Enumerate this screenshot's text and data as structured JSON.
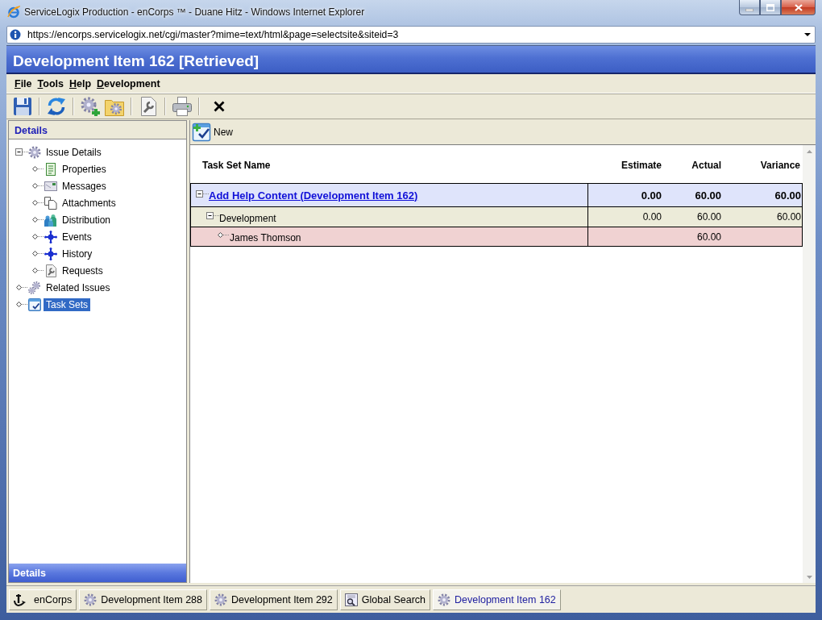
{
  "window": {
    "title": "ServiceLogix Production - enCorps ™ - Duane Hitz - Windows Internet Explorer"
  },
  "address_bar": {
    "url": "https://encorps.servicelogix.net/cgi/master?mime=text/html&page=selectsite&siteid=3"
  },
  "app": {
    "title": "Development Item 162 [Retrieved]",
    "menu": [
      "File",
      "Tools",
      "Help",
      "Development"
    ]
  },
  "sidebar": {
    "title": "Details",
    "tree": [
      {
        "label": "Issue Details",
        "kind": "issue",
        "expanded": true,
        "selected": false,
        "children": [
          {
            "label": "Properties",
            "kind": "properties",
            "expanded": false,
            "selected": false
          },
          {
            "label": "Messages",
            "kind": "messages",
            "expanded": false,
            "selected": false
          },
          {
            "label": "Attachments",
            "kind": "attachments",
            "expanded": false,
            "selected": false
          },
          {
            "label": "Distribution",
            "kind": "distribution",
            "expanded": false,
            "selected": false
          },
          {
            "label": "Events",
            "kind": "events",
            "expanded": false,
            "selected": false
          },
          {
            "label": "History",
            "kind": "history",
            "expanded": false,
            "selected": false
          },
          {
            "label": "Requests",
            "kind": "requests",
            "expanded": false,
            "selected": false
          }
        ]
      },
      {
        "label": "Related Issues",
        "kind": "related",
        "expanded": false,
        "selected": false
      },
      {
        "label": "Task Sets",
        "kind": "tasksets",
        "expanded": false,
        "selected": true
      }
    ],
    "footer": "Details"
  },
  "task_panel": {
    "new_button": "New",
    "table": {
      "columns": [
        "Task Set Name",
        "Estimate",
        "Actual",
        "Variance"
      ],
      "rows": [
        {
          "name": "Add Help Content (Development Item 162)",
          "estimate": "0.00",
          "actual": "60.00",
          "variance": "60.00",
          "expanded": true,
          "children": [
            {
              "name": "Development",
              "estimate": "0.00",
              "actual": "60.00",
              "variance": "60.00",
              "expanded": true,
              "children": [
                {
                  "name": "James Thomson",
                  "actual": "60.00",
                  "expanded": false
                }
              ]
            }
          ]
        }
      ]
    }
  },
  "taskbar": {
    "tabs": [
      {
        "label": "enCorps",
        "kind": "home",
        "selected": false
      },
      {
        "label": "Development Item 288",
        "kind": "item",
        "selected": false
      },
      {
        "label": "Development Item 292",
        "kind": "item",
        "selected": false
      },
      {
        "label": "Global Search",
        "kind": "search",
        "selected": false
      },
      {
        "label": "Development Item 162",
        "kind": "item",
        "selected": true
      }
    ]
  }
}
